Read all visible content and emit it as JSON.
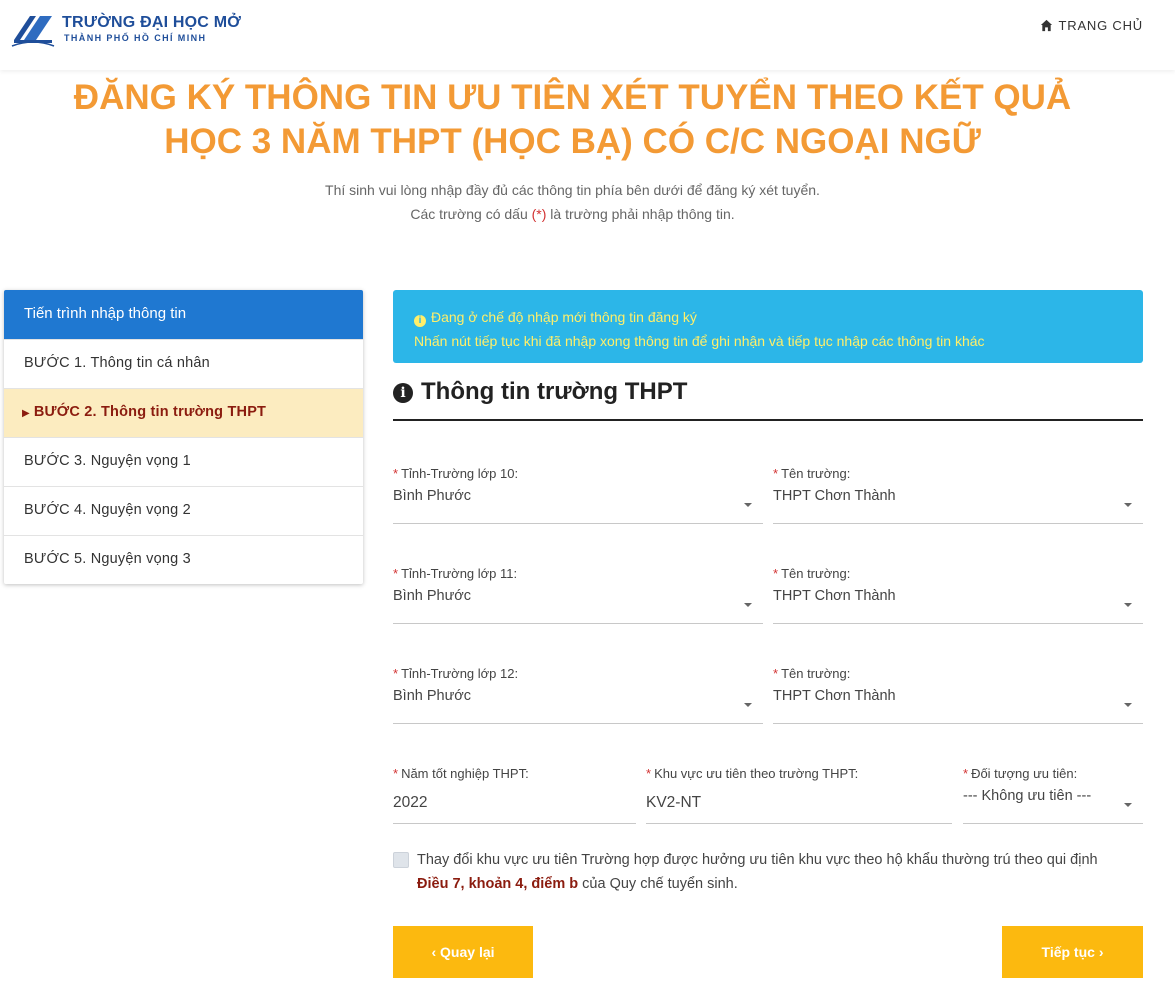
{
  "header": {
    "logo_line1": "TRƯỜNG ĐẠI HỌC MỞ",
    "logo_line2": "THÀNH PHỐ HỒ CHÍ MINH",
    "home_label": "TRANG CHỦ"
  },
  "page": {
    "title_line1": "ĐĂNG KÝ THÔNG TIN ƯU TIÊN XÉT TUYỂN THEO KẾT QUẢ",
    "title_line2": "HỌC 3 NĂM THPT (HỌC BẠ) CÓ C/C NGOẠI NGỮ",
    "intro_line1": "Thí sinh vui lòng nhập đầy đủ các thông tin phía bên dưới để đăng ký xét tuyển.",
    "intro_line2_pre": "Các trường có dấu ",
    "intro_line2_mark": "(*)",
    "intro_line2_post": " là trường phải nhập thông tin."
  },
  "sidebar": {
    "heading": "Tiến trình nhập thông tin",
    "steps": [
      {
        "label": "BƯỚC 1. Thông tin cá nhân"
      },
      {
        "label": "BƯỚC 2. Thông tin trường THPT"
      },
      {
        "label": "BƯỚC 3. Nguyện vọng 1"
      },
      {
        "label": "BƯỚC 4. Nguyện vọng 2"
      },
      {
        "label": "BƯỚC 5. Nguyện vọng 3"
      }
    ],
    "active_step": 2
  },
  "alert": {
    "line1": "Đang ở chế độ nhập mới thông tin đăng ký",
    "line2": "Nhấn nút tiếp tục khi đã nhập xong thông tin để ghi nhận và tiếp tục nhập các thông tin khác"
  },
  "section": {
    "title": "Thông tin trường THPT"
  },
  "form": {
    "required_mark": "*",
    "province10": {
      "label": "Tỉnh-Trường lớp 10:",
      "value": "Bình Phước"
    },
    "school10": {
      "label": "Tên trường:",
      "value": "THPT Chơn Thành"
    },
    "province11": {
      "label": "Tỉnh-Trường lớp 11:",
      "value": "Bình Phước"
    },
    "school11": {
      "label": "Tên trường:",
      "value": "THPT Chơn Thành"
    },
    "province12": {
      "label": "Tỉnh-Trường lớp 12:",
      "value": "Bình Phước"
    },
    "school12": {
      "label": "Tên trường:",
      "value": "THPT Chơn Thành"
    },
    "grad_year": {
      "label": "Năm tốt nghiệp THPT:",
      "value": "2022"
    },
    "priority_area": {
      "label": "Khu vực ưu tiên theo trường THPT:",
      "value": "KV2-NT"
    },
    "priority_group": {
      "label": "Đối tượng ưu tiên:",
      "value": "--- Không ưu tiên ---"
    },
    "change_area": {
      "text": "Thay đổi khu vực ưu tiên Trường hợp được hưởng ưu tiên khu vực theo hộ khẩu thường trú theo qui định",
      "law": "Điều 7, khoản 4, điểm b",
      "suffix": " của Quy chế tuyển sinh.",
      "checked": false
    }
  },
  "buttons": {
    "back": "‹ Quay lại",
    "next": "Tiếp tục ›"
  },
  "colors": {
    "title": "#f39a35",
    "sidebar_head": "#1f78d1",
    "active_step_bg": "#fcecc0",
    "alert_bg": "#2cb6e8",
    "alert_text": "#ffef6a",
    "button_bg": "#fcb90f",
    "required": "#d23232"
  }
}
